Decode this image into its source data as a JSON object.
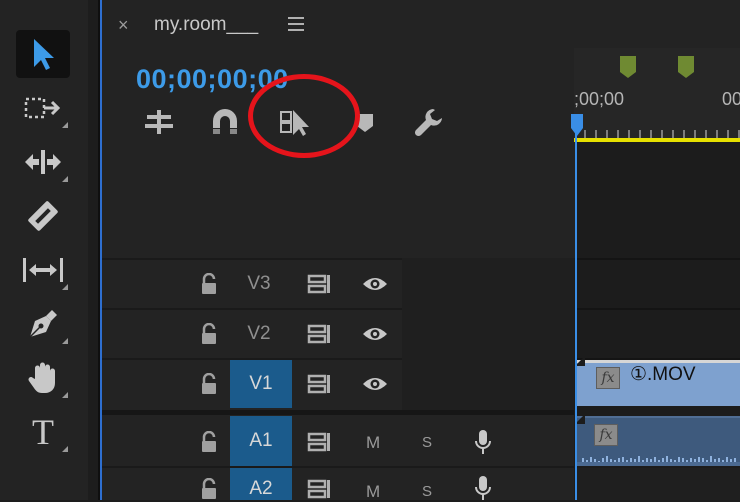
{
  "sequence": {
    "close_glyph": "×",
    "title": "my.room___",
    "timecode": "00;00;00;00"
  },
  "ruler": {
    "timecode_start": ";00;00",
    "timecode_next": "00"
  },
  "tools": [
    "selection-tool",
    "track-select-tool",
    "ripple-edit-tool",
    "razor-tool",
    "slip-tool",
    "pen-tool",
    "hand-tool",
    "type-tool"
  ],
  "type_tool_glyph": "T",
  "tracks": {
    "v3": "V3",
    "v2": "V2",
    "v1": "V1",
    "a1": "A1",
    "a2": "A2",
    "mute": "M",
    "solo": "S"
  },
  "clips": {
    "v1_name": "①.MOV",
    "fx_glyph": "fx"
  },
  "colors": {
    "accent": "#3d9be8",
    "target_on": "#1b5b8c",
    "video_clip": "#7ea1cf",
    "audio_clip": "#3e5a7d",
    "work_area": "#e6e000",
    "marker": "#6f8a32",
    "annotation": "#e5141b"
  }
}
